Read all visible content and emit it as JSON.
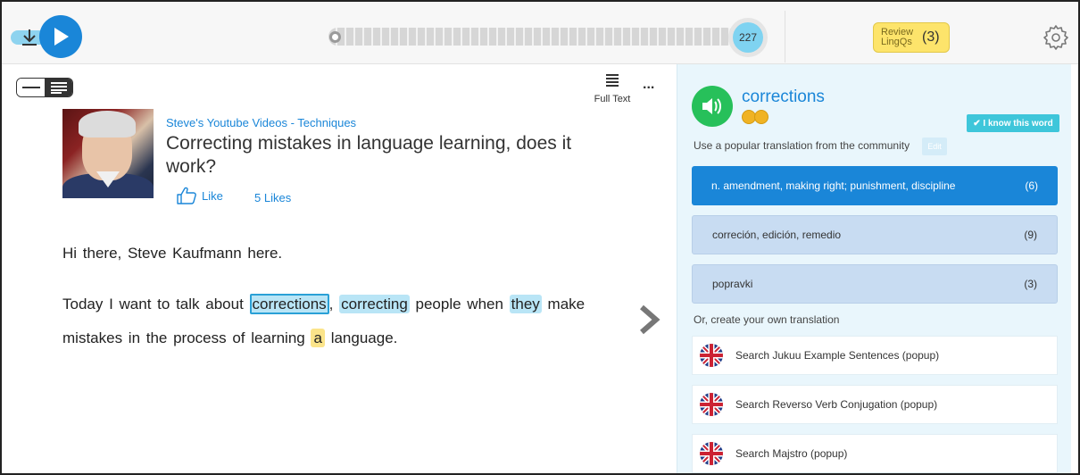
{
  "player": {
    "play_icon": "play-icon",
    "download_icon": "download-icon",
    "word_count": "227",
    "progress": 0.0
  },
  "review": {
    "label": "Review LingQs",
    "count": "(3)"
  },
  "settings": {
    "icon": "gear-icon"
  },
  "reader": {
    "full_text_label": "Full Text",
    "more_label": "...",
    "course": "Steve's Youtube Videos - Techniques",
    "title": "Correcting mistakes in language learning, does it work?",
    "like_label": "Like",
    "likes_count": "5 Likes",
    "paragraph1": "Hi there, Steve Kaufmann here.",
    "paragraph2": {
      "w1": "Today I want to talk about",
      "w2": "corrections",
      "w3": ",",
      "w4": "correcting",
      "w5": "people when",
      "w6": "they",
      "w7": "make mistakes in the process of learning",
      "w8": "a",
      "w9": "language."
    }
  },
  "panel": {
    "term": "corrections",
    "know_label": "✔ I know this word",
    "use_popular": "Use a popular translation from the community",
    "edit_label": "Edit",
    "hints": [
      {
        "text": "n. amendment, making right; punishment, discipline",
        "count": "(6)"
      },
      {
        "text": "correción, edición, remedio",
        "count": "(9)"
      },
      {
        "text": "popravki",
        "count": "(3)"
      }
    ],
    "create_own": "Or, create your own translation",
    "dictionaries": [
      {
        "label": "Search Jukuu Example Sentences (popup)"
      },
      {
        "label": "Search Reverso Verb Conjugation (popup)"
      },
      {
        "label": "Search Majstro (popup)"
      }
    ]
  },
  "colors": {
    "accent_blue": "#1a86d8",
    "highlight_blue": "#b9e5f6",
    "highlight_yellow": "#fbe48a",
    "speaker_green": "#27c05a",
    "review_yellow": "#fde46b",
    "know_cyan": "#3ec6da"
  }
}
